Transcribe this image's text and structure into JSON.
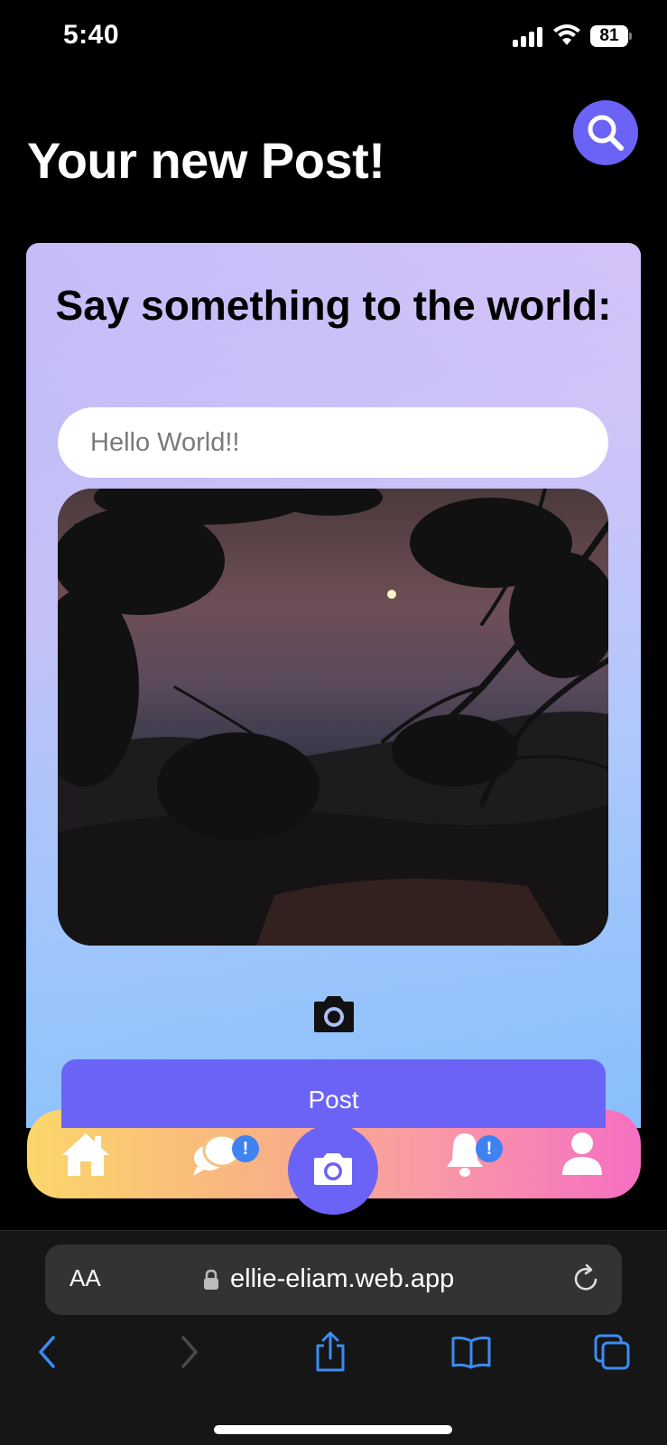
{
  "status_bar": {
    "time": "5:40",
    "battery": "81"
  },
  "page": {
    "title": "Your new Post!"
  },
  "card": {
    "heading": "Say something to the world:",
    "input_placeholder": "Hello World!!",
    "post_button": "Post"
  },
  "tab_bar": {
    "items": [
      {
        "icon": "home-icon"
      },
      {
        "icon": "chat-icon",
        "badge": "!"
      },
      {
        "icon": "camera-icon"
      },
      {
        "icon": "bell-icon",
        "badge": "!"
      },
      {
        "icon": "profile-icon"
      }
    ]
  },
  "browser": {
    "aa_label": "AA",
    "url": "ellie-eliam.web.app"
  },
  "colors": {
    "accent": "#6b63f5",
    "badge": "#3f82f1",
    "ios_blue": "#3b8cf3"
  }
}
